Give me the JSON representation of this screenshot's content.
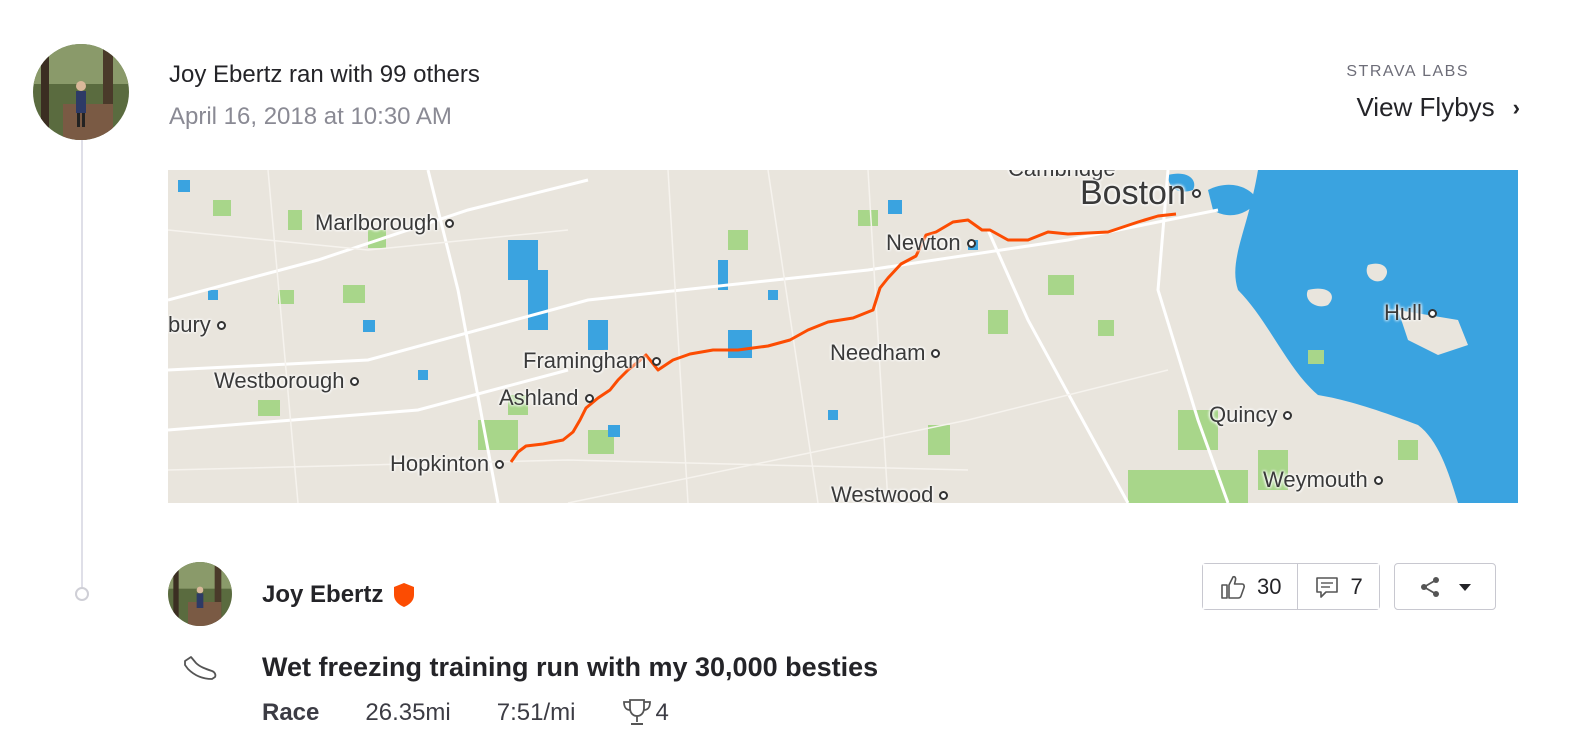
{
  "group": {
    "title": "Joy Ebertz ran with 99 others",
    "date": "April 16, 2018 at 10:30 AM"
  },
  "labs": {
    "label": "STRAVA LABS",
    "link": "View Flybys"
  },
  "map": {
    "labels": {
      "cambridge": "Cambridge",
      "boston": "Boston",
      "marlborough": "Marlborough",
      "newton": "Newton",
      "sudbury": "bury",
      "hull": "Hull",
      "framingham": "Framingham",
      "needham": "Needham",
      "westborough": "Westborough",
      "ashland": "Ashland",
      "quincy": "Quincy",
      "hopkinton": "Hopkinton",
      "weymouth": "Weymouth",
      "westwood": "Westwood"
    },
    "colors": {
      "land": "#e9e5dd",
      "water": "#3aa3e0",
      "park": "#a8d68a",
      "route": "#fc4c02"
    }
  },
  "activity": {
    "athlete": "Joy Ebertz",
    "title": "Wet freezing training run with my 30,000 besties",
    "type": "Race",
    "distance": "26.35mi",
    "pace": "7:51/mi",
    "achievements": "4",
    "kudos": "30",
    "comments": "7"
  },
  "icons": {
    "kudos": "thumbs-up-icon",
    "comments": "comment-icon",
    "share": "share-icon",
    "dropdown": "caret-down-icon",
    "shoe": "run-shoe-icon",
    "trophy": "trophy-icon",
    "badge": "subscriber-shield-icon",
    "chevron": "chevron-right-icon"
  },
  "colors": {
    "accent": "#fc4c02",
    "text": "#242428",
    "muted": "#8a8a94",
    "border": "#c8c8d0"
  }
}
